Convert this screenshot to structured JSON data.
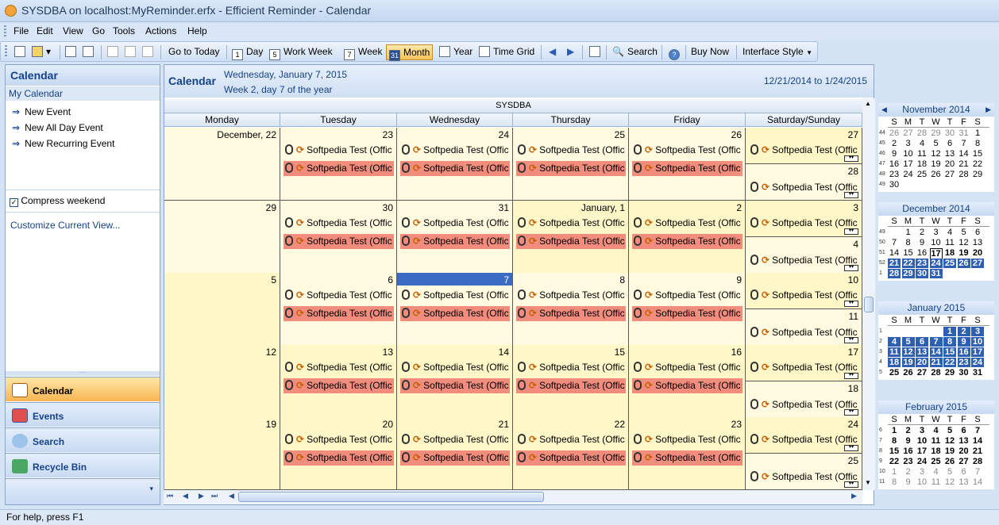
{
  "window": {
    "title": "SYSDBA on localhost:MyReminder.erfx - Efficient Reminder - Calendar"
  },
  "menu": [
    "File",
    "Edit",
    "View",
    "Go",
    "Tools",
    "Actions",
    "Help"
  ],
  "toolbar": {
    "goto_today": "Go to Today",
    "day": "Day",
    "work_week": "Work Week",
    "week": "Week",
    "month": "Month",
    "month_icon": "31",
    "year": "Year",
    "time_grid": "Time Grid",
    "search": "Search",
    "buy_now": "Buy Now",
    "interface_style": "Interface Style"
  },
  "left_panel": {
    "title": "Calendar",
    "subtitle": "My Calendar",
    "links": [
      "New Event",
      "New All Day Event",
      "New Recurring Event"
    ],
    "compress_weekend": "Compress weekend",
    "customize": "Customize Current View...",
    "nav": [
      "Calendar",
      "Events",
      "Search",
      "Recycle Bin"
    ]
  },
  "main": {
    "title": "Calendar",
    "date_line1": "Wednesday, January 7, 2015",
    "date_line2": "Week 2, day 7 of the year",
    "range": "12/21/2014 to 1/24/2015",
    "resource": "SYSDBA",
    "day_headers": [
      "Monday",
      "Tuesday",
      "Wednesday",
      "Thursday",
      "Friday",
      "Saturday/Sunday"
    ],
    "event_title": "Softpedia Test (Offic",
    "weeks": [
      {
        "mon": "December, 22",
        "tue": "23",
        "wed": "24",
        "thu": "25",
        "fri": "26",
        "sat": "27",
        "sun": "28"
      },
      {
        "mon": "29",
        "tue": "30",
        "wed": "31",
        "thu": "January, 1",
        "fri": "2",
        "sat": "3",
        "sun": "4"
      },
      {
        "mon": "5",
        "tue": "6",
        "wed": "7",
        "thu": "8",
        "fri": "9",
        "sat": "10",
        "sun": "11"
      },
      {
        "mon": "12",
        "tue": "13",
        "wed": "14",
        "thu": "15",
        "fri": "16",
        "sat": "17",
        "sun": "18"
      },
      {
        "mon": "19",
        "tue": "20",
        "wed": "21",
        "thu": "22",
        "fri": "23",
        "sat": "24",
        "sun": "25"
      }
    ]
  },
  "mini_calendars": [
    {
      "title": "November 2014",
      "dow": [
        "S",
        "M",
        "T",
        "W",
        "T",
        "F",
        "S"
      ],
      "weeks": [
        "44",
        "45",
        "46",
        "47",
        "48",
        "49"
      ],
      "rows": [
        [
          "26",
          "27",
          "28",
          "29",
          "30",
          "31",
          "1"
        ],
        [
          "2",
          "3",
          "4",
          "5",
          "6",
          "7",
          "8"
        ],
        [
          "9",
          "10",
          "11",
          "12",
          "13",
          "14",
          "15"
        ],
        [
          "16",
          "17",
          "18",
          "19",
          "20",
          "21",
          "22"
        ],
        [
          "23",
          "24",
          "25",
          "26",
          "27",
          "28",
          "29"
        ],
        [
          "30",
          "",
          "",
          "",
          "",
          "",
          ""
        ]
      ]
    },
    {
      "title": "December 2014",
      "dow": [
        "S",
        "M",
        "T",
        "W",
        "T",
        "F",
        "S"
      ],
      "weeks": [
        "49",
        "50",
        "51",
        "52",
        "1"
      ],
      "rows": [
        [
          "",
          "1",
          "2",
          "3",
          "4",
          "5",
          "6"
        ],
        [
          "7",
          "8",
          "9",
          "10",
          "11",
          "12",
          "13"
        ],
        [
          "14",
          "15",
          "16",
          "17",
          "18",
          "19",
          "20"
        ],
        [
          "21",
          "22",
          "23",
          "24",
          "25",
          "26",
          "27"
        ],
        [
          "28",
          "29",
          "30",
          "31",
          "",
          "",
          ""
        ]
      ]
    },
    {
      "title": "January 2015",
      "dow": [
        "S",
        "M",
        "T",
        "W",
        "T",
        "F",
        "S"
      ],
      "weeks": [
        "1",
        "2",
        "3",
        "4",
        "5"
      ],
      "rows": [
        [
          "",
          "",
          "",
          "",
          "1",
          "2",
          "3"
        ],
        [
          "4",
          "5",
          "6",
          "7",
          "8",
          "9",
          "10"
        ],
        [
          "11",
          "12",
          "13",
          "14",
          "15",
          "16",
          "17"
        ],
        [
          "18",
          "19",
          "20",
          "21",
          "22",
          "23",
          "24"
        ],
        [
          "25",
          "26",
          "27",
          "28",
          "29",
          "30",
          "31"
        ]
      ]
    },
    {
      "title": "February 2015",
      "dow": [
        "S",
        "M",
        "T",
        "W",
        "T",
        "F",
        "S"
      ],
      "weeks": [
        "6",
        "7",
        "8",
        "9",
        "10",
        "11"
      ],
      "rows": [
        [
          "1",
          "2",
          "3",
          "4",
          "5",
          "6",
          "7"
        ],
        [
          "8",
          "9",
          "10",
          "11",
          "12",
          "13",
          "14"
        ],
        [
          "15",
          "16",
          "17",
          "18",
          "19",
          "20",
          "21"
        ],
        [
          "22",
          "23",
          "24",
          "25",
          "26",
          "27",
          "28"
        ],
        [
          "1",
          "2",
          "3",
          "4",
          "5",
          "6",
          "7"
        ],
        [
          "8",
          "9",
          "10",
          "11",
          "12",
          "13",
          "14"
        ]
      ]
    }
  ],
  "status": "For help, press F1"
}
